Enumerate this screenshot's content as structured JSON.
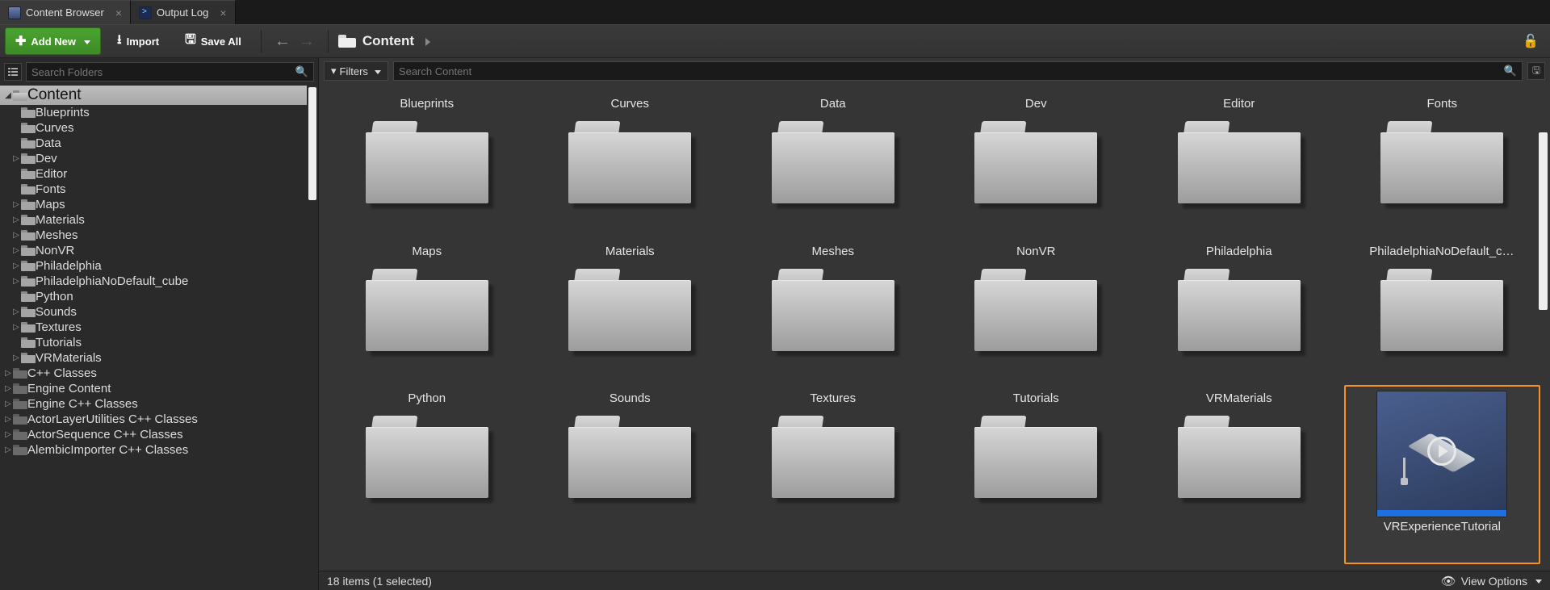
{
  "tabs": [
    {
      "label": "Content Browser",
      "icon": "cb",
      "active": true
    },
    {
      "label": "Output Log",
      "icon": "log",
      "active": false
    }
  ],
  "toolbar": {
    "add_new": "Add New",
    "import": "Import",
    "save_all": "Save All"
  },
  "breadcrumb": {
    "root": "Content"
  },
  "sidebar": {
    "search_placeholder": "Search Folders",
    "tree": [
      {
        "label": "Content",
        "depth": 0,
        "expander": "down",
        "icon": "open",
        "selected": true,
        "root": true
      },
      {
        "label": "Blueprints",
        "depth": 1,
        "expander": "",
        "icon": "norm"
      },
      {
        "label": "Curves",
        "depth": 1,
        "expander": "",
        "icon": "norm"
      },
      {
        "label": "Data",
        "depth": 1,
        "expander": "",
        "icon": "norm"
      },
      {
        "label": "Dev",
        "depth": 1,
        "expander": "right",
        "icon": "norm"
      },
      {
        "label": "Editor",
        "depth": 1,
        "expander": "",
        "icon": "norm"
      },
      {
        "label": "Fonts",
        "depth": 1,
        "expander": "",
        "icon": "norm"
      },
      {
        "label": "Maps",
        "depth": 1,
        "expander": "right",
        "icon": "norm"
      },
      {
        "label": "Materials",
        "depth": 1,
        "expander": "right",
        "icon": "norm"
      },
      {
        "label": "Meshes",
        "depth": 1,
        "expander": "right",
        "icon": "norm"
      },
      {
        "label": "NonVR",
        "depth": 1,
        "expander": "right",
        "icon": "norm"
      },
      {
        "label": "Philadelphia",
        "depth": 1,
        "expander": "right",
        "icon": "norm"
      },
      {
        "label": "PhiladelphiaNoDefault_cube",
        "depth": 1,
        "expander": "right",
        "icon": "norm"
      },
      {
        "label": "Python",
        "depth": 1,
        "expander": "",
        "icon": "norm"
      },
      {
        "label": "Sounds",
        "depth": 1,
        "expander": "right",
        "icon": "norm"
      },
      {
        "label": "Textures",
        "depth": 1,
        "expander": "right",
        "icon": "norm"
      },
      {
        "label": "Tutorials",
        "depth": 1,
        "expander": "",
        "icon": "norm"
      },
      {
        "label": "VRMaterials",
        "depth": 1,
        "expander": "right",
        "icon": "norm"
      },
      {
        "label": "C++ Classes",
        "depth": 0,
        "expander": "right",
        "icon": "dark"
      },
      {
        "label": "Engine Content",
        "depth": 0,
        "expander": "right",
        "icon": "dark"
      },
      {
        "label": "Engine C++ Classes",
        "depth": 0,
        "expander": "right",
        "icon": "dark"
      },
      {
        "label": "ActorLayerUtilities C++ Classes",
        "depth": 0,
        "expander": "right",
        "icon": "dark"
      },
      {
        "label": "ActorSequence C++ Classes",
        "depth": 0,
        "expander": "right",
        "icon": "dark"
      },
      {
        "label": "AlembicImporter C++ Classes",
        "depth": 0,
        "expander": "right",
        "icon": "dark"
      }
    ]
  },
  "content": {
    "filters_label": "Filters",
    "search_placeholder": "Search Content",
    "items": [
      {
        "name": "Blueprints",
        "type": "folder"
      },
      {
        "name": "Curves",
        "type": "folder"
      },
      {
        "name": "Data",
        "type": "folder"
      },
      {
        "name": "Dev",
        "type": "folder"
      },
      {
        "name": "Editor",
        "type": "folder"
      },
      {
        "name": "Fonts",
        "type": "folder"
      },
      {
        "name": "Maps",
        "type": "folder"
      },
      {
        "name": "Materials",
        "type": "folder"
      },
      {
        "name": "Meshes",
        "type": "folder"
      },
      {
        "name": "NonVR",
        "type": "folder"
      },
      {
        "name": "Philadelphia",
        "type": "folder"
      },
      {
        "name": "PhiladelphiaNoDefault_cube",
        "type": "folder"
      },
      {
        "name": "Python",
        "type": "folder"
      },
      {
        "name": "Sounds",
        "type": "folder"
      },
      {
        "name": "Textures",
        "type": "folder"
      },
      {
        "name": "Tutorials",
        "type": "folder"
      },
      {
        "name": "VRMaterials",
        "type": "folder"
      },
      {
        "name": "VRExperienceTutorial",
        "type": "asset",
        "selected": true
      }
    ]
  },
  "status": {
    "text": "18 items (1 selected)",
    "view_options": "View Options"
  }
}
